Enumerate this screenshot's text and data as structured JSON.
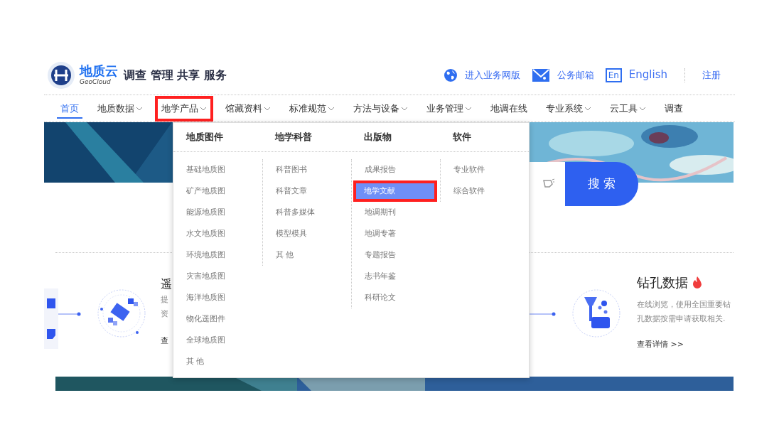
{
  "header": {
    "logo": {
      "name": "地质云",
      "sub": "GeoCloud"
    },
    "slogan": "调查 管理 共享 服务",
    "links": [
      {
        "kind": "globe",
        "label": "进入业务网版"
      },
      {
        "kind": "mail",
        "label": "公务邮箱"
      },
      {
        "kind": "lang",
        "badge": "En",
        "label": "English"
      },
      {
        "kind": "plain",
        "label": "注册"
      }
    ]
  },
  "nav": [
    {
      "label": "首页",
      "selected": true,
      "dropdown": false,
      "annotated": false
    },
    {
      "label": "地质数据",
      "selected": false,
      "dropdown": true,
      "annotated": false
    },
    {
      "label": "地学产品",
      "selected": false,
      "dropdown": true,
      "annotated": true
    },
    {
      "label": "馆藏资料",
      "selected": false,
      "dropdown": true,
      "annotated": false
    },
    {
      "label": "标准规范",
      "selected": false,
      "dropdown": true,
      "annotated": false
    },
    {
      "label": "方法与设备",
      "selected": false,
      "dropdown": true,
      "annotated": false
    },
    {
      "label": "业务管理",
      "selected": false,
      "dropdown": true,
      "annotated": false
    },
    {
      "label": "地调在线",
      "selected": false,
      "dropdown": false,
      "annotated": false
    },
    {
      "label": "专业系统",
      "selected": false,
      "dropdown": true,
      "annotated": false
    },
    {
      "label": "云工具",
      "selected": false,
      "dropdown": true,
      "annotated": false
    },
    {
      "label": "调查",
      "selected": false,
      "dropdown": false,
      "annotated": false
    }
  ],
  "mega_menu": {
    "columns": [
      {
        "title": "地质图件",
        "items": [
          {
            "label": "基础地质图",
            "selected": false,
            "annotated": false
          },
          {
            "label": "矿产地质图",
            "selected": false,
            "annotated": false
          },
          {
            "label": "能源地质图",
            "selected": false,
            "annotated": false
          },
          {
            "label": "水文地质图",
            "selected": false,
            "annotated": false
          },
          {
            "label": "环境地质图",
            "selected": false,
            "annotated": false
          },
          {
            "label": "灾害地质图",
            "selected": false,
            "annotated": false
          },
          {
            "label": "海洋地质图",
            "selected": false,
            "annotated": false
          },
          {
            "label": "物化遥图件",
            "selected": false,
            "annotated": false
          },
          {
            "label": "全球地质图",
            "selected": false,
            "annotated": false
          },
          {
            "label": "其 他",
            "selected": false,
            "annotated": false
          }
        ]
      },
      {
        "title": "地学科普",
        "items": [
          {
            "label": "科普图书",
            "selected": false,
            "annotated": false
          },
          {
            "label": "科普文章",
            "selected": false,
            "annotated": false
          },
          {
            "label": "科普多媒体",
            "selected": false,
            "annotated": false
          },
          {
            "label": "模型模具",
            "selected": false,
            "annotated": false
          },
          {
            "label": "其 他",
            "selected": false,
            "annotated": false
          }
        ]
      },
      {
        "title": "出版物",
        "items": [
          {
            "label": "成果报告",
            "selected": false,
            "annotated": false
          },
          {
            "label": "地学文献",
            "selected": true,
            "annotated": true
          },
          {
            "label": "地调期刊",
            "selected": false,
            "annotated": false
          },
          {
            "label": "地调专著",
            "selected": false,
            "annotated": false
          },
          {
            "label": "专题报告",
            "selected": false,
            "annotated": false
          },
          {
            "label": "志书年鉴",
            "selected": false,
            "annotated": false
          },
          {
            "label": "科研论文",
            "selected": false,
            "annotated": false
          }
        ]
      },
      {
        "title": "软件",
        "items": [
          {
            "label": "专业软件",
            "selected": false,
            "annotated": false
          },
          {
            "label": "综合软件",
            "selected": false,
            "annotated": false
          }
        ]
      }
    ]
  },
  "search": {
    "button": "搜 索"
  },
  "cards": [
    {
      "kind": "satellite",
      "title": "遥",
      "hot": false,
      "lines": [
        "提",
        "资"
      ],
      "link": "查"
    },
    {
      "kind": "drill",
      "title": "钻孔数据",
      "hot": true,
      "lines": [
        "在线浏览，使用全国重要钻",
        "孔数据按需申请获取相关."
      ],
      "link": "查看详情",
      "link_arrow": ">>"
    }
  ]
}
